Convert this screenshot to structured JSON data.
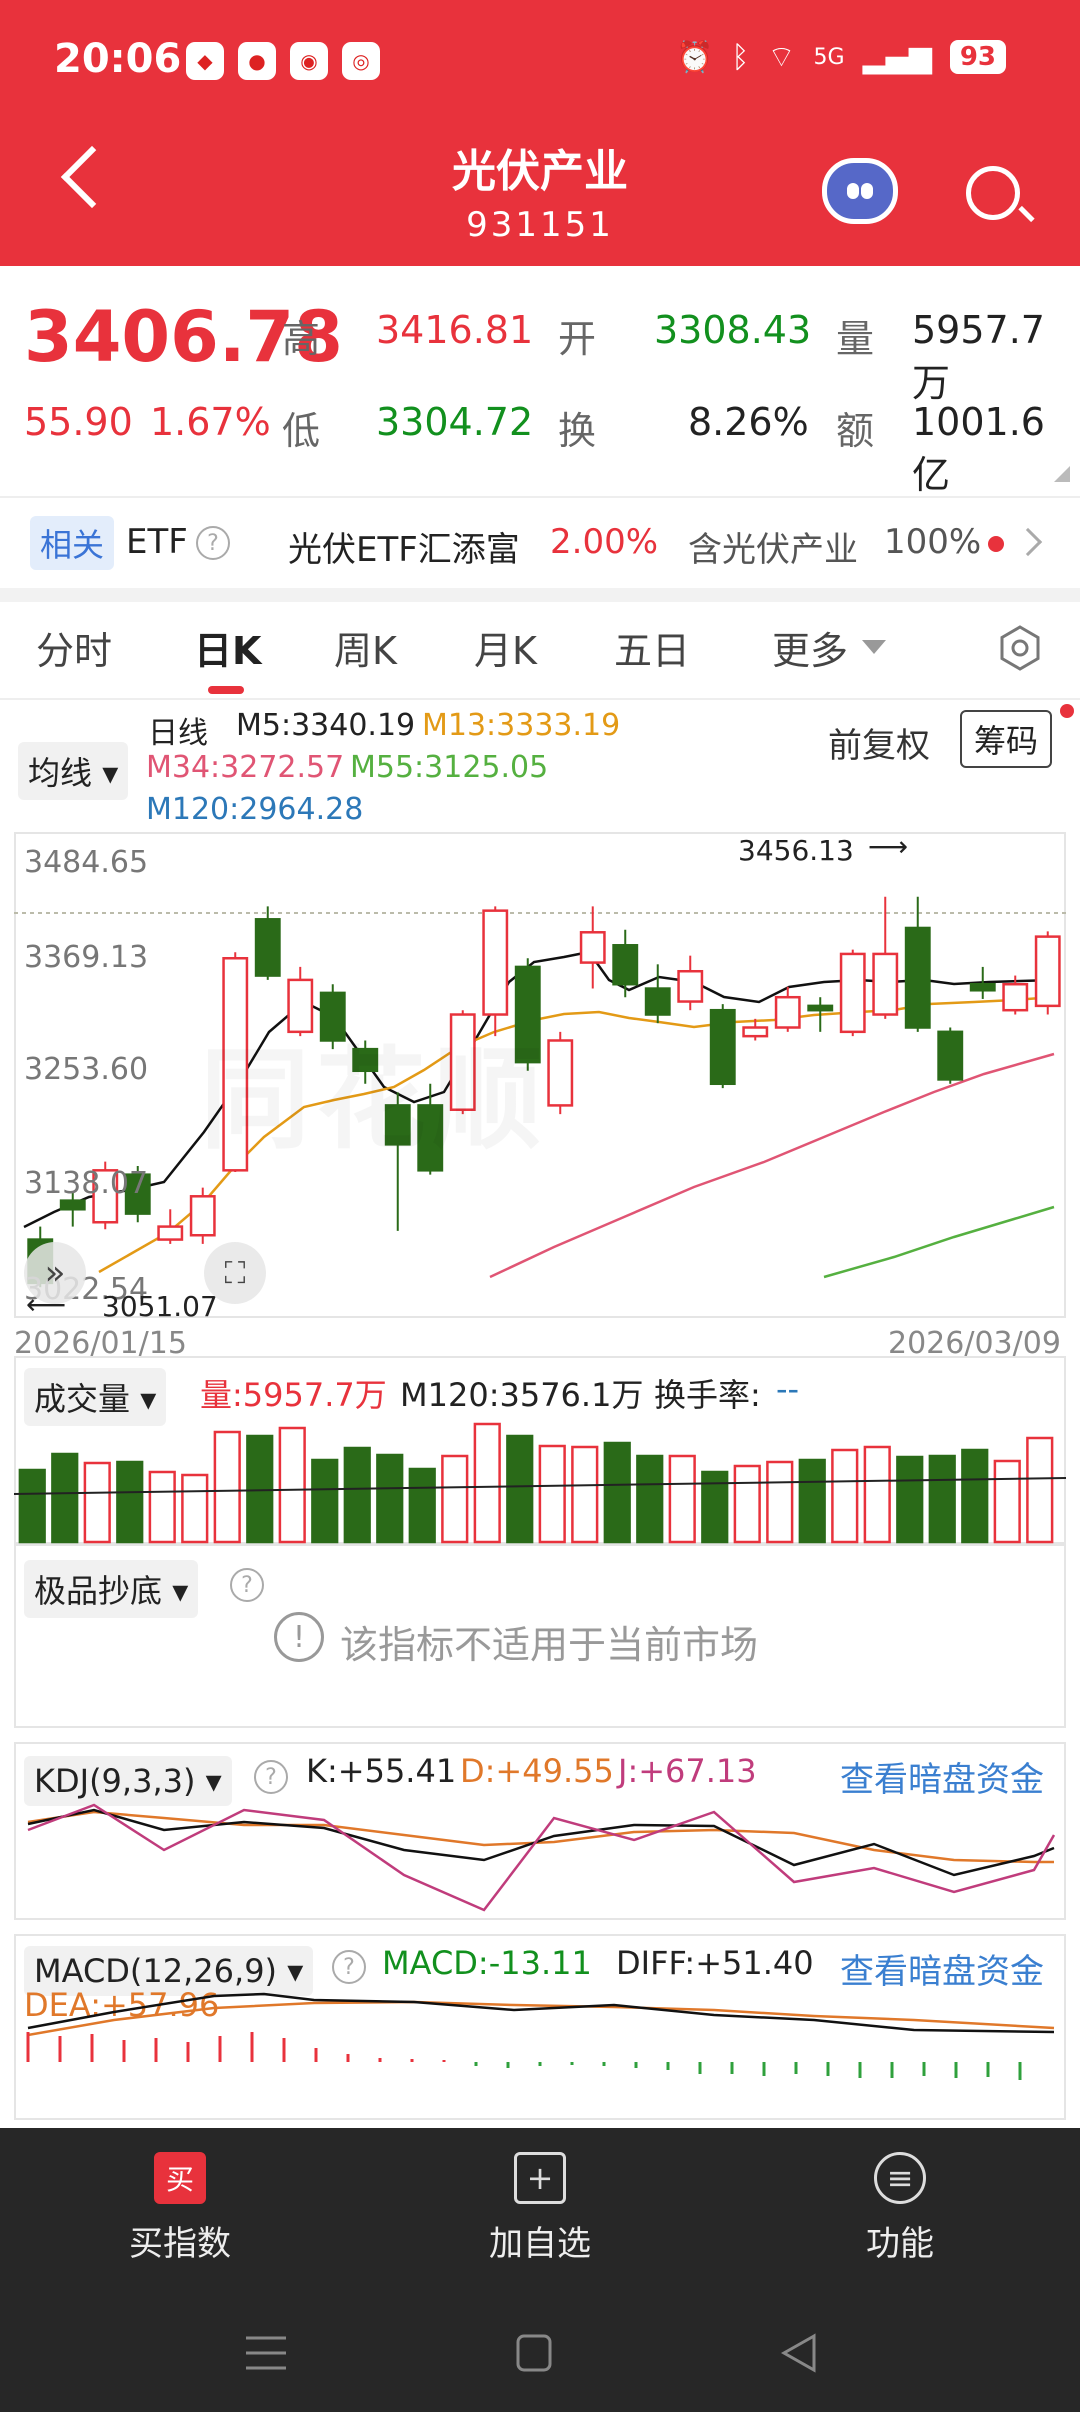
{
  "status": {
    "time": "20:06",
    "battery": "93",
    "network": "5G",
    "apps": [
      "app1",
      "app2",
      "app3",
      "app4"
    ]
  },
  "header": {
    "title": "光伏产业",
    "code": "931151"
  },
  "quote": {
    "price": "3406.78",
    "change": "55.90",
    "change_pct": "1.67%",
    "high_label": "高",
    "high": "3416.81",
    "open_label": "开",
    "open": "3308.43",
    "vol_label": "量",
    "volume": "5957.7万",
    "low_label": "低",
    "low": "3304.72",
    "turnover_label": "换",
    "turnover": "8.26%",
    "amount_label": "额",
    "amount": "1001.6亿"
  },
  "etf": {
    "tag": "相关",
    "label": "ETF",
    "name": "光伏ETF汇添富",
    "pct": "2.00%",
    "contains": "含光伏产业",
    "weight": "100%"
  },
  "tabs": [
    "分时",
    "日K",
    "周K",
    "月K",
    "五日",
    "更多"
  ],
  "kline": {
    "indicator": "均线",
    "period": "日线",
    "m5": "M5:3340.19",
    "m13": "M13:3333.19",
    "m34": "M34:3272.57",
    "m55": "M55:3125.05",
    "m120": "M120:2964.28",
    "adjust": "前复权",
    "chip": "筹码",
    "y_labels": [
      "3484.65",
      "3369.13",
      "3253.60",
      "3138.07",
      "3022.54"
    ],
    "max_note": "3456.13",
    "min_note": "3051.07",
    "date_start": "2026/01/15",
    "date_end": "2026/03/09"
  },
  "chart_data": {
    "type": "candlestick",
    "dates": [
      "2026/01/15",
      "2026/03/09"
    ],
    "ylim": [
      3022.54,
      3484.65
    ],
    "candles": [
      {
        "o": 3060,
        "c": 3010,
        "h": 3075,
        "l": 3005
      },
      {
        "o": 3105,
        "c": 3095,
        "h": 3115,
        "l": 3075
      },
      {
        "o": 3080,
        "c": 3140,
        "h": 3150,
        "l": 3072
      },
      {
        "o": 3135,
        "c": 3090,
        "h": 3145,
        "l": 3080
      },
      {
        "o": 3060,
        "c": 3075,
        "h": 3095,
        "l": 3055
      },
      {
        "o": 3065,
        "c": 3110,
        "h": 3120,
        "l": 3055
      },
      {
        "o": 3140,
        "c": 3385,
        "h": 3392,
        "l": 3138
      },
      {
        "o": 3430,
        "c": 3365,
        "h": 3445,
        "l": 3360
      },
      {
        "o": 3300,
        "c": 3360,
        "h": 3375,
        "l": 3295
      },
      {
        "o": 3345,
        "c": 3290,
        "h": 3355,
        "l": 3280
      },
      {
        "o": 3280,
        "c": 3255,
        "h": 3290,
        "l": 3240
      },
      {
        "o": 3215,
        "c": 3170,
        "h": 3230,
        "l": 3070
      },
      {
        "o": 3215,
        "c": 3140,
        "h": 3240,
        "l": 3135
      },
      {
        "o": 3210,
        "c": 3320,
        "h": 3325,
        "l": 3205
      },
      {
        "o": 3320,
        "c": 3440,
        "h": 3445,
        "l": 3295
      },
      {
        "o": 3375,
        "c": 3265,
        "h": 3385,
        "l": 3255
      },
      {
        "o": 3215,
        "c": 3290,
        "h": 3300,
        "l": 3205
      },
      {
        "o": 3380,
        "c": 3415,
        "h": 3445,
        "l": 3350
      },
      {
        "o": 3400,
        "c": 3355,
        "h": 3418,
        "l": 3340
      },
      {
        "o": 3350,
        "c": 3320,
        "h": 3378,
        "l": 3310
      },
      {
        "o": 3335,
        "c": 3370,
        "h": 3388,
        "l": 3325
      },
      {
        "o": 3325,
        "c": 3240,
        "h": 3332,
        "l": 3235
      },
      {
        "o": 3295,
        "c": 3305,
        "h": 3315,
        "l": 3290
      },
      {
        "o": 3305,
        "c": 3340,
        "h": 3352,
        "l": 3300
      },
      {
        "o": 3330,
        "c": 3325,
        "h": 3340,
        "l": 3300
      },
      {
        "o": 3300,
        "c": 3390,
        "h": 3395,
        "l": 3295
      },
      {
        "o": 3320,
        "c": 3390,
        "h": 3456,
        "l": 3315
      },
      {
        "o": 3420,
        "c": 3305,
        "h": 3456,
        "l": 3300
      },
      {
        "o": 3300,
        "c": 3245,
        "h": 3305,
        "l": 3240
      },
      {
        "o": 3355,
        "c": 3348,
        "h": 3375,
        "l": 3338
      },
      {
        "o": 3325,
        "c": 3355,
        "h": 3365,
        "l": 3320
      },
      {
        "o": 3330,
        "c": 3410,
        "h": 3416,
        "l": 3320
      }
    ],
    "volume": {
      "label": "成交量",
      "value": "量:5957.7万",
      "m120": "M120:3576.1万",
      "turnover": "换手率:",
      "turnover_val": "--",
      "bars": [
        0.72,
        0.88,
        0.79,
        0.8,
        0.7,
        0.67,
        1.1,
        1.06,
        1.14,
        0.82,
        0.94,
        0.87,
        0.73,
        0.86,
        1.18,
        1.06,
        0.96,
        0.95,
        0.99,
        0.86,
        0.86,
        0.7,
        0.76,
        0.8,
        0.82,
        0.92,
        0.95,
        0.85,
        0.86,
        0.92,
        0.81,
        1.04
      ]
    },
    "kdj": {
      "label": "KDJ(9,3,3)",
      "k": "K:+55.41",
      "d": "D:+49.55",
      "j": "J:+67.13",
      "link": "查看暗盘资金"
    },
    "macd": {
      "label": "MACD(12,26,9)",
      "macd": "MACD:-13.11",
      "diff": "DIFF:+51.40",
      "dea": "DEA:+57.96",
      "link": "查看暗盘资金"
    }
  },
  "bottom_indicator": {
    "label": "极品抄底",
    "notice": "该指标不适用于当前市场"
  },
  "bottom_nav": [
    {
      "label": "买指数",
      "icon": "买"
    },
    {
      "label": "加自选",
      "icon": "+"
    },
    {
      "label": "功能",
      "icon": "≡"
    }
  ],
  "colors": {
    "brand": "#E8323C",
    "up": "#E8323C",
    "down": "#2A6A18",
    "ma5": "#111111",
    "ma13": "#E39A16",
    "ma34": "#E05574",
    "ma55": "#55B040",
    "ma120": "#2C78B8"
  }
}
